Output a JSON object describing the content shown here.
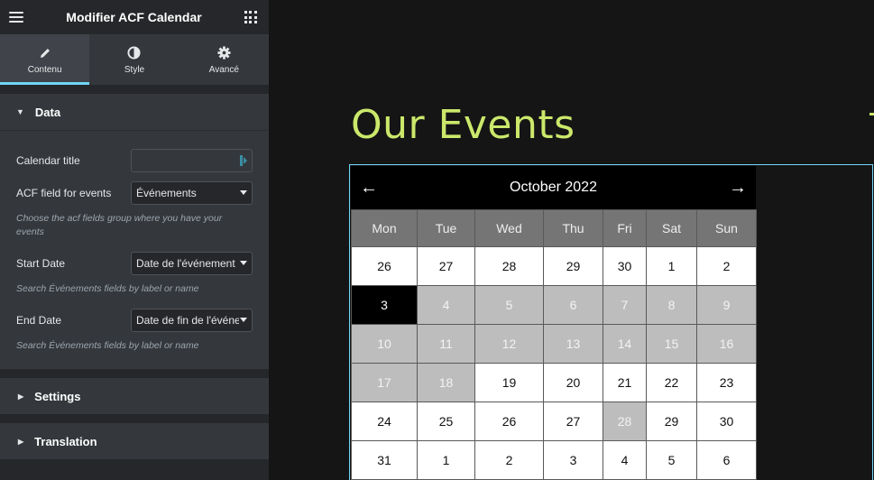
{
  "editor": {
    "title": "Modifier ACF Calendar",
    "tabs": [
      {
        "label": "Contenu",
        "icon": "pencil-icon"
      },
      {
        "label": "Style",
        "icon": "contrast-icon"
      },
      {
        "label": "Avancé",
        "icon": "gear-icon"
      }
    ],
    "data_section": {
      "title": "Data",
      "calendar_title": {
        "label": "Calendar title",
        "value": ""
      },
      "acf_field": {
        "label": "ACF field for events",
        "value": "Événements",
        "hint": "Choose the acf fields group where you have your events"
      },
      "start_date": {
        "label": "Start Date",
        "value": "Date de l'événement",
        "hint": "Search Événements fields by label or name"
      },
      "end_date": {
        "label": "End Date",
        "value": "Date de fin de l'événement",
        "hint": "Search Événements fields by label or name"
      }
    },
    "settings_section": {
      "title": "Settings"
    },
    "translation_section": {
      "title": "Translation"
    }
  },
  "main": {
    "heading": "Our Events",
    "calendar": {
      "month_label": "October 2022",
      "prev": "←",
      "next": "→",
      "weekdays": [
        "Mon",
        "Tue",
        "Wed",
        "Thu",
        "Fri",
        "Sat",
        "Sun"
      ],
      "weeks": [
        [
          {
            "d": "26",
            "s": "normal"
          },
          {
            "d": "27",
            "s": "normal"
          },
          {
            "d": "28",
            "s": "normal"
          },
          {
            "d": "29",
            "s": "normal"
          },
          {
            "d": "30",
            "s": "normal"
          },
          {
            "d": "1",
            "s": "normal"
          },
          {
            "d": "2",
            "s": "normal"
          }
        ],
        [
          {
            "d": "3",
            "s": "today"
          },
          {
            "d": "4",
            "s": "event"
          },
          {
            "d": "5",
            "s": "event"
          },
          {
            "d": "6",
            "s": "event"
          },
          {
            "d": "7",
            "s": "event"
          },
          {
            "d": "8",
            "s": "event"
          },
          {
            "d": "9",
            "s": "event"
          }
        ],
        [
          {
            "d": "10",
            "s": "event"
          },
          {
            "d": "11",
            "s": "event"
          },
          {
            "d": "12",
            "s": "event"
          },
          {
            "d": "13",
            "s": "event"
          },
          {
            "d": "14",
            "s": "event"
          },
          {
            "d": "15",
            "s": "event"
          },
          {
            "d": "16",
            "s": "event"
          }
        ],
        [
          {
            "d": "17",
            "s": "event"
          },
          {
            "d": "18",
            "s": "event"
          },
          {
            "d": "19",
            "s": "normal"
          },
          {
            "d": "20",
            "s": "normal"
          },
          {
            "d": "21",
            "s": "normal"
          },
          {
            "d": "22",
            "s": "normal"
          },
          {
            "d": "23",
            "s": "normal"
          }
        ],
        [
          {
            "d": "24",
            "s": "normal"
          },
          {
            "d": "25",
            "s": "normal"
          },
          {
            "d": "26",
            "s": "normal"
          },
          {
            "d": "27",
            "s": "normal"
          },
          {
            "d": "28",
            "s": "event"
          },
          {
            "d": "29",
            "s": "normal"
          },
          {
            "d": "30",
            "s": "normal"
          }
        ],
        [
          {
            "d": "31",
            "s": "normal"
          },
          {
            "d": "1",
            "s": "normal"
          },
          {
            "d": "2",
            "s": "normal"
          },
          {
            "d": "3",
            "s": "normal"
          },
          {
            "d": "4",
            "s": "normal"
          },
          {
            "d": "5",
            "s": "normal"
          },
          {
            "d": "6",
            "s": "normal"
          }
        ]
      ]
    }
  },
  "colors": {
    "accent": "#71d7f7",
    "heading": "#cbe86b",
    "today_bg": "#000000",
    "event_bg": "#bdbdbd"
  }
}
